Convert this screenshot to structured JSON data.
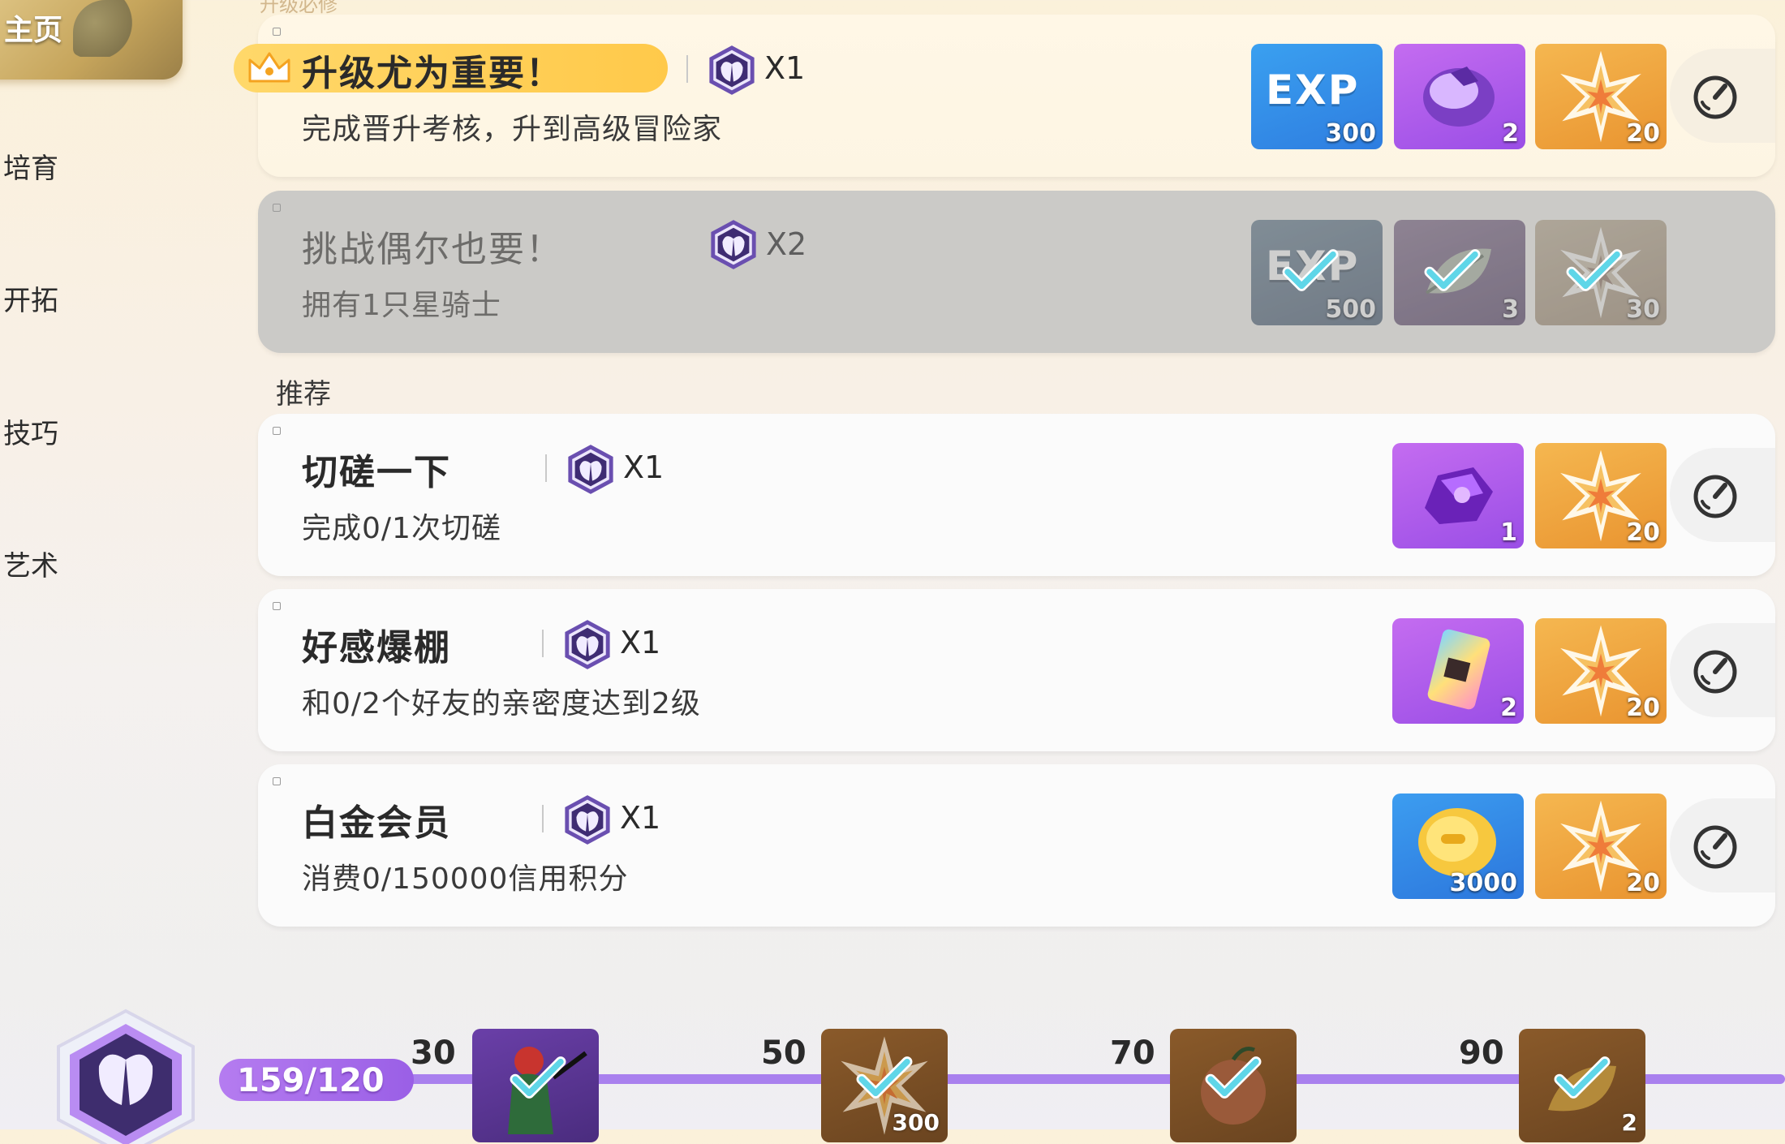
{
  "nav": {
    "home": "主页",
    "items": [
      "培育",
      "开拓",
      "技巧",
      "艺术"
    ]
  },
  "section_top": "升级必修",
  "tasks": [
    {
      "title": "升级尤为重要！",
      "desc": "完成晋升考核，升到高级冒险家",
      "token_count": "X1",
      "rewards": [
        {
          "icon": "exp-icon",
          "label": "EXP",
          "num": "300"
        },
        {
          "icon": "purple-crystal-icon",
          "num": "2"
        },
        {
          "icon": "star-shard-icon",
          "num": "20"
        }
      ]
    },
    {
      "title": "挑战偶尔也要！",
      "desc": "拥有1只星骑士",
      "token_count": "X2",
      "rewards": [
        {
          "icon": "exp-icon",
          "label": "EXP",
          "num": "500"
        },
        {
          "icon": "leaf-icon",
          "num": "3"
        },
        {
          "icon": "star-shard-icon",
          "num": "30"
        }
      ]
    },
    {
      "title": "切磋一下",
      "desc": "完成0/1次切磋",
      "token_count": "X1",
      "rewards": [
        {
          "icon": "purple-ore-icon",
          "num": "1"
        },
        {
          "icon": "star-shard-icon",
          "num": "20"
        }
      ]
    },
    {
      "title": "好感爆棚",
      "desc": "和0/2个好友的亲密度达到2级",
      "token_count": "X1",
      "rewards": [
        {
          "icon": "rainbow-card-icon",
          "num": "2"
        },
        {
          "icon": "star-shard-icon",
          "num": "20"
        }
      ]
    },
    {
      "title": "白金会员",
      "desc": "消费0/150000信用积分",
      "token_count": "X1",
      "rewards": [
        {
          "icon": "gold-coin-icon",
          "num": "3000"
        },
        {
          "icon": "star-shard-icon",
          "num": "20"
        }
      ]
    }
  ],
  "section_recommend": "推荐",
  "progress": {
    "text": "159/120",
    "milestones": [
      {
        "level": "30",
        "num": "",
        "icon": "character-icon"
      },
      {
        "level": "50",
        "num": "300",
        "icon": "star-shard-icon"
      },
      {
        "level": "70",
        "num": "",
        "icon": "fruit-icon"
      },
      {
        "level": "90",
        "num": "2",
        "icon": "leaf-icon"
      }
    ]
  },
  "colors": {
    "accent_purple": "#a980ee",
    "banner_yellow": "#ffc94a",
    "reward_blue": "#2e7de0",
    "reward_purple": "#9a4ee6",
    "reward_orange": "#e99430",
    "check_teal": "#5fd6e8"
  }
}
